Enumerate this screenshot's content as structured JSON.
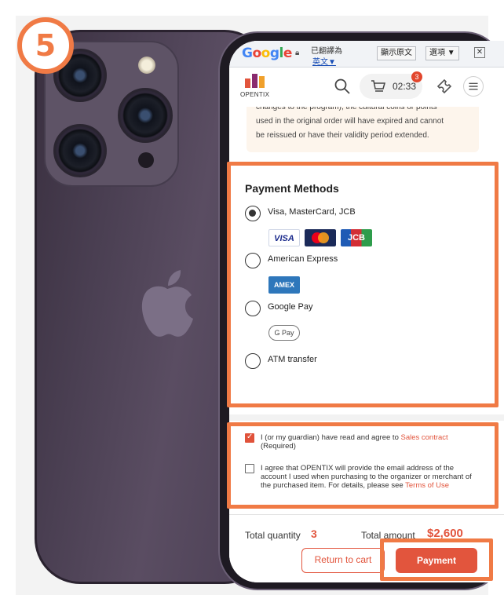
{
  "step_number": "5",
  "translate_bar": {
    "logo_parts": [
      "G",
      "o",
      "o",
      "g",
      "l",
      "e"
    ],
    "status": "已翻譯為",
    "language": "英文",
    "language_dropdown": "▼",
    "show_original": "顯示原文",
    "options": "選項 ▼",
    "close": "✕"
  },
  "header": {
    "logo_text": "OPENTIX",
    "cart_timer": "02:33",
    "cart_count": "3"
  },
  "notice": {
    "line1": "changes to the program), the cultural coins or points",
    "line2": "used in the original order will have expired and cannot",
    "line3": "be reissued or have their validity period extended."
  },
  "payment_methods": {
    "title": "Payment Methods",
    "options": [
      {
        "label": "Visa, MasterCard, JCB",
        "selected": true
      },
      {
        "label": "American Express",
        "selected": false
      },
      {
        "label": "Google Pay",
        "selected": false
      },
      {
        "label": "ATM transfer",
        "selected": false
      }
    ],
    "card_logos": {
      "visa": "VISA",
      "jcb": "JCB",
      "amex": "AMEX",
      "gpay": "G Pay"
    }
  },
  "agreements": {
    "sales": {
      "text": "I (or my guardian) have read and agree to ",
      "link": "Sales contract",
      "suffix": "(Required)",
      "checked": true
    },
    "email": {
      "text": "I agree that OPENTIX will provide the email address of the account I used when purchasing to the organizer or merchant of the purchased item. For details, please see ",
      "link": "Terms of Use",
      "checked": false
    }
  },
  "totals": {
    "quantity_label": "Total quantity",
    "quantity": "3",
    "amount_label": "Total amount",
    "amount": "$2,600"
  },
  "buttons": {
    "return_to_cart": "Return to cart",
    "payment": "Payment"
  },
  "colors": {
    "accent": "#e2553d",
    "highlight": "#f07a45"
  }
}
